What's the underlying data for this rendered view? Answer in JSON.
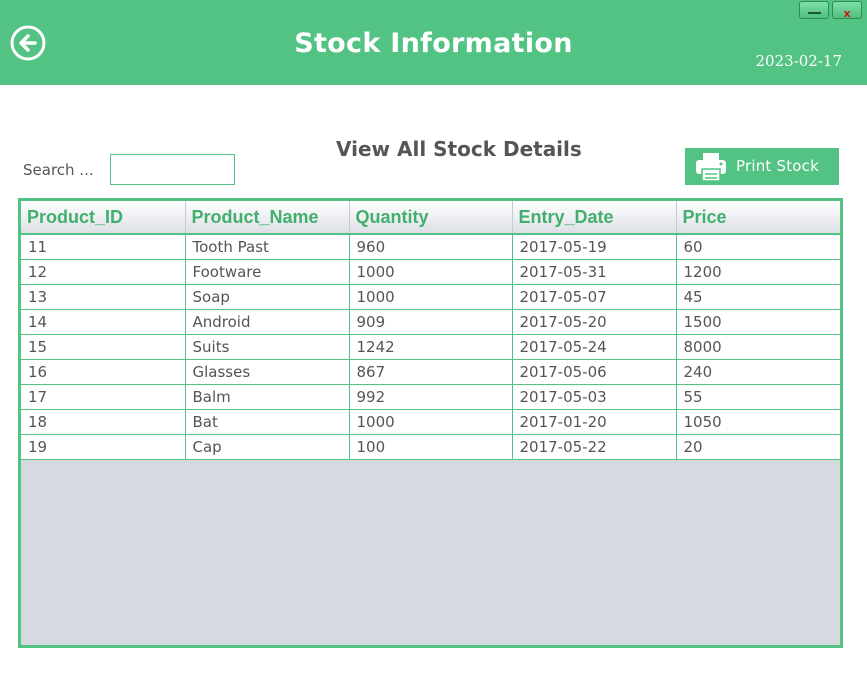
{
  "header": {
    "title": "Stock Information",
    "date": "2023-02-17",
    "close_label": "x"
  },
  "search": {
    "label": "Search ...",
    "value": ""
  },
  "subtitle": "View All Stock Details",
  "print_button": {
    "label": "Print Stock"
  },
  "table": {
    "columns": [
      "Product_ID",
      "Product_Name",
      "Quantity",
      "Entry_Date",
      "Price"
    ],
    "rows": [
      [
        "11",
        "Tooth Past",
        "960",
        "2017-05-19",
        "60"
      ],
      [
        "12",
        "Footware",
        "1000",
        "2017-05-31",
        "1200"
      ],
      [
        "13",
        "Soap",
        "1000",
        "2017-05-07",
        "45"
      ],
      [
        "14",
        "Android",
        "909",
        "2017-05-20",
        "1500"
      ],
      [
        "15",
        "Suits",
        "1242",
        "2017-05-24",
        "8000"
      ],
      [
        "16",
        "Glasses",
        "867",
        "2017-05-06",
        "240"
      ],
      [
        "17",
        "Balm",
        "992",
        "2017-05-03",
        "55"
      ],
      [
        "18",
        "Bat",
        "1000",
        "2017-01-20",
        "1050"
      ],
      [
        "19",
        "Cap",
        "100",
        "2017-05-22",
        "20"
      ]
    ]
  },
  "colors": {
    "accent": "#52c383",
    "header_text": "#42b06c",
    "body_text": "#555555",
    "empty_area": "#d6d9e0"
  },
  "icons": [
    "back-arrow-icon",
    "printer-icon",
    "minimize-icon",
    "close-icon"
  ]
}
